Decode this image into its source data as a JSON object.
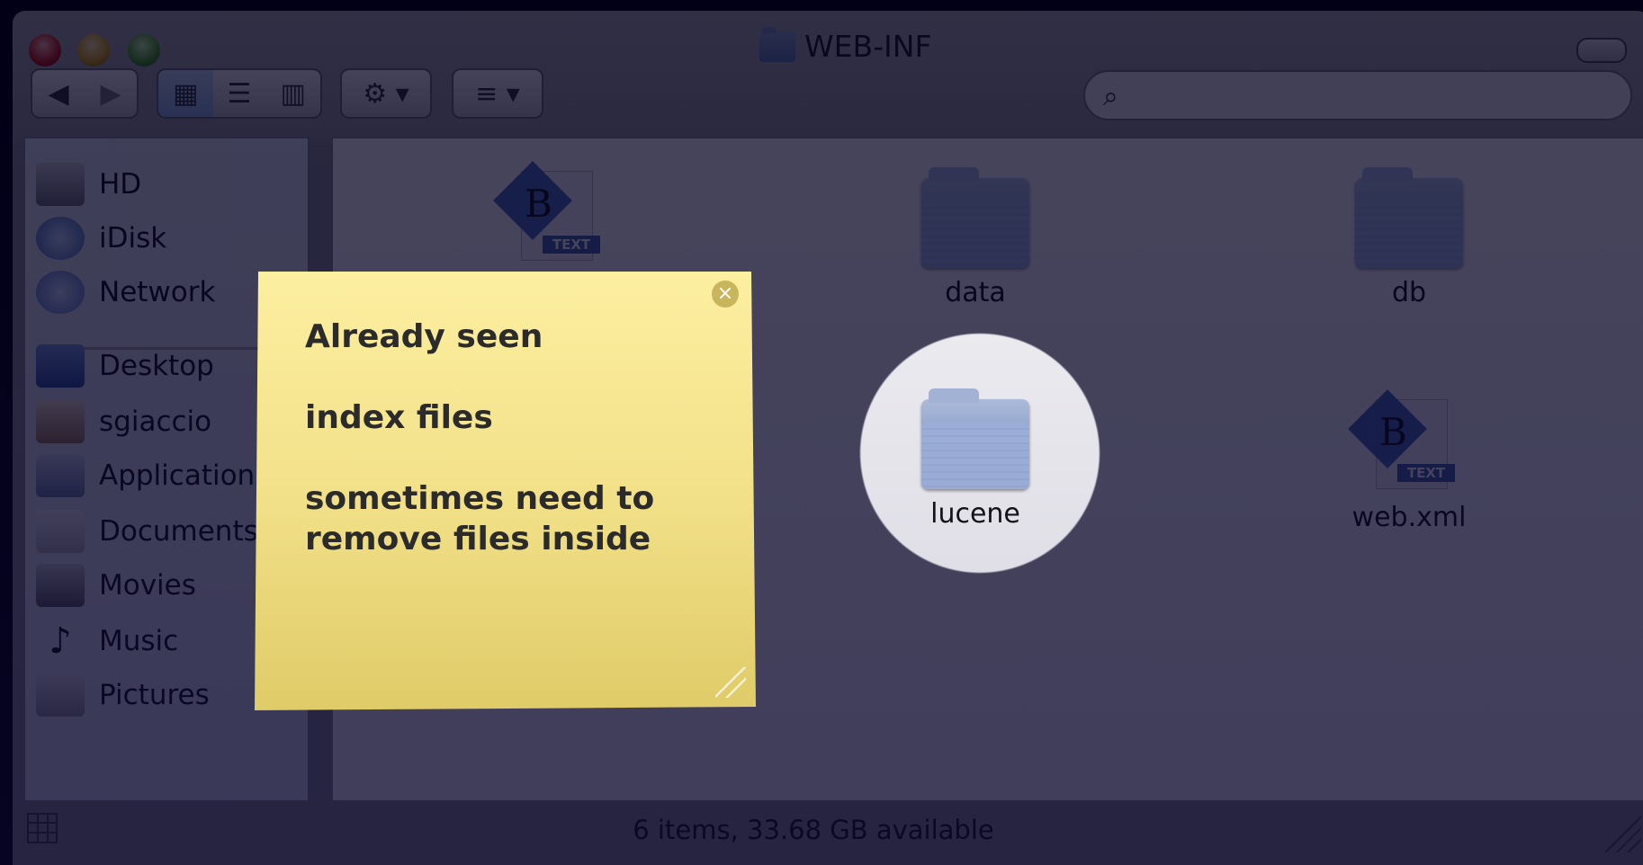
{
  "window": {
    "title": "WEB-INF"
  },
  "toolbar": {
    "back_label": "◀",
    "forward_label": "▶",
    "view_icon_label": "▦",
    "view_list_label": "☰",
    "view_column_label": "▥",
    "action_label": "⚙ ▾",
    "arrange_label": "≡ ▾",
    "search_placeholder": ""
  },
  "sidebar": {
    "items": [
      {
        "label": "HD",
        "icon": "hard-drive-icon"
      },
      {
        "label": "iDisk",
        "icon": "idisk-icon"
      },
      {
        "label": "Network",
        "icon": "network-icon"
      },
      {
        "label": "Desktop",
        "icon": "desktop-icon"
      },
      {
        "label": "sgiaccio",
        "icon": "home-icon"
      },
      {
        "label": "Applications",
        "icon": "applications-icon"
      },
      {
        "label": "Documents",
        "icon": "documents-icon"
      },
      {
        "label": "Movies",
        "icon": "movies-icon"
      },
      {
        "label": "Music",
        "icon": "music-icon"
      },
      {
        "label": "Pictures",
        "icon": "pictures-icon"
      }
    ]
  },
  "files": [
    {
      "label": "",
      "type": "xml"
    },
    {
      "label": "data",
      "type": "folder"
    },
    {
      "label": "db",
      "type": "folder"
    },
    {
      "label": "lucene",
      "type": "folder"
    },
    {
      "label": "web.xml",
      "type": "xml"
    }
  ],
  "xml_badge": "TEXT",
  "status": {
    "text": "6 items, 33.68 GB available"
  },
  "note": {
    "lines": [
      "Already seen",
      "index files",
      "sometimes need to remove files inside"
    ]
  }
}
